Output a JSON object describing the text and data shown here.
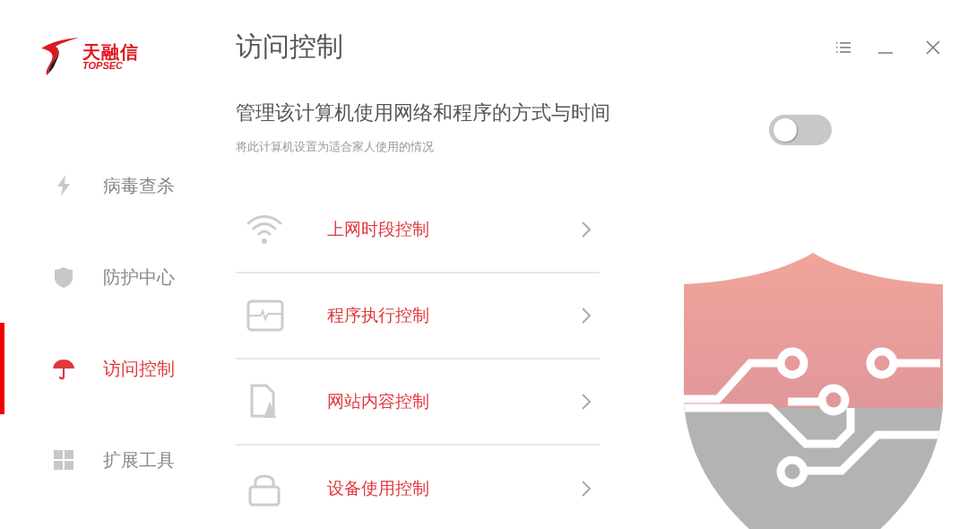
{
  "logo": {
    "name": "天融信",
    "tagline": "TOPSEC"
  },
  "sidebar": {
    "items": [
      {
        "label": "病毒查杀",
        "kind": "bolt",
        "selected": false
      },
      {
        "label": "防护中心",
        "kind": "shield",
        "selected": false
      },
      {
        "label": "访问控制",
        "kind": "umbrella",
        "selected": true
      },
      {
        "label": "扩展工具",
        "kind": "grid",
        "selected": false
      }
    ]
  },
  "page": {
    "title": "访问控制",
    "heading": "管理该计算机使用网络和程序的方式与时间",
    "description": "将此计算机设置为适合家人使用的情况",
    "enabled": false
  },
  "controls": [
    {
      "label": "上网时段控制",
      "kind": "wifi"
    },
    {
      "label": "程序执行控制",
      "kind": "monitor"
    },
    {
      "label": "网站内容控制",
      "kind": "document"
    },
    {
      "label": "设备使用控制",
      "kind": "lock"
    }
  ]
}
